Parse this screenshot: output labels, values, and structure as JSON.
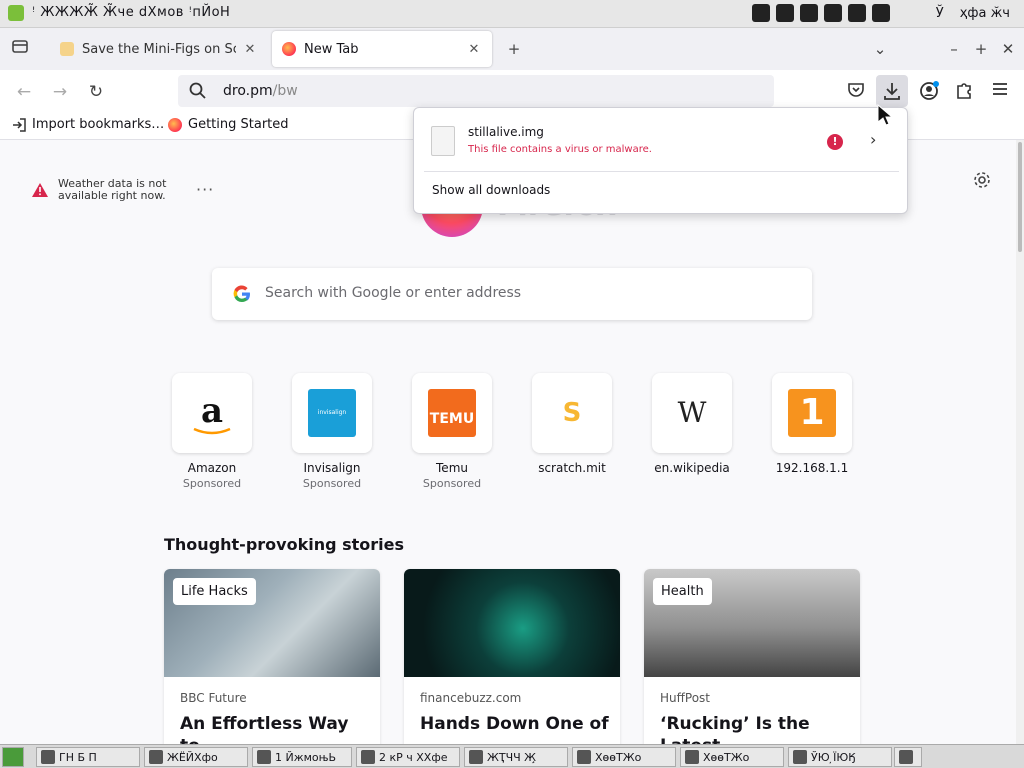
{
  "os_panel": {
    "apps_text": "ꜝ ЖЖЖЖ̃ Ж̃че   dХмов   ꜝпЙоН",
    "keyboard": "Ў",
    "clock": "ҳфа ӂч"
  },
  "tabs": [
    {
      "title": "Save the Mini-Figs on Scratc",
      "close": "✕"
    },
    {
      "title": "New Tab",
      "close": "✕"
    }
  ],
  "tabbar": {
    "new_tab": "+",
    "list_tabs": "⌄",
    "minimize": "–",
    "maximize": "+",
    "close": "✕"
  },
  "nav": {
    "back": "←",
    "forward": "→",
    "reload": "↻",
    "url_main": "dro.pm",
    "url_path": "/bw"
  },
  "bookmarks": [
    {
      "label": "Import bookmarks…"
    },
    {
      "label": "Getting Started"
    }
  ],
  "weather": {
    "line1": "Weather data is not",
    "line2": "available right now.",
    "more": "···"
  },
  "brand": {
    "wordmark": "Firefox"
  },
  "search": {
    "placeholder": "Search with Google or enter address"
  },
  "top_sites": [
    {
      "name": "Amazon",
      "sponsored": "Sponsored",
      "color": "#ffffff"
    },
    {
      "name": "Invisalign",
      "sponsored": "Sponsored",
      "color": "#1a9fd8"
    },
    {
      "name": "Temu",
      "sponsored": "Sponsored",
      "color": "#f26b1d"
    },
    {
      "name": "scratch.mit",
      "sponsored": "",
      "color": "#ffffff"
    },
    {
      "name": "en.wikipedia",
      "sponsored": "",
      "color": "#ffffff"
    },
    {
      "name": "192.168.1.1",
      "sponsored": "",
      "color": "#f7931e"
    }
  ],
  "site_logos": {
    "amazon": "a",
    "invisalign": "invisalign",
    "temu": "TEMU",
    "scratch": "S",
    "wikipedia": "W",
    "router": "1"
  },
  "stories": {
    "title": "Thought-provoking stories",
    "items": [
      {
        "tag": "Life Hacks",
        "source": "BBC Future",
        "headline": "An Effortless Way to"
      },
      {
        "tag": "",
        "source": "financebuzz.com",
        "headline": "Hands Down One of"
      },
      {
        "tag": "Health",
        "source": "HuffPost",
        "headline": "‘Rucking’ Is the Latest"
      }
    ]
  },
  "downloads": {
    "filename": "stillalive.img",
    "status": "This file contains a virus or malware.",
    "error_mark": "!",
    "open_arrow": "›",
    "show_all": "Show all downloads"
  },
  "taskbar": [
    {
      "label": "ГН   Б П"
    },
    {
      "label": "ЖЁЙХфо"
    },
    {
      "label": "1 ЙжмоњЬ"
    },
    {
      "label": "2 кР ч ХХфе"
    },
    {
      "label": "ЖҬЧЧ Ж̧"
    },
    {
      "label": "ХөөТЖо"
    },
    {
      "label": "ХөөТЖо"
    },
    {
      "label": "ЎЮ ̦ЇЮӃ"
    }
  ],
  "colors": {
    "accent": "#0061e0",
    "danger": "#d7264c",
    "page_bg": "#f9f9fb"
  }
}
